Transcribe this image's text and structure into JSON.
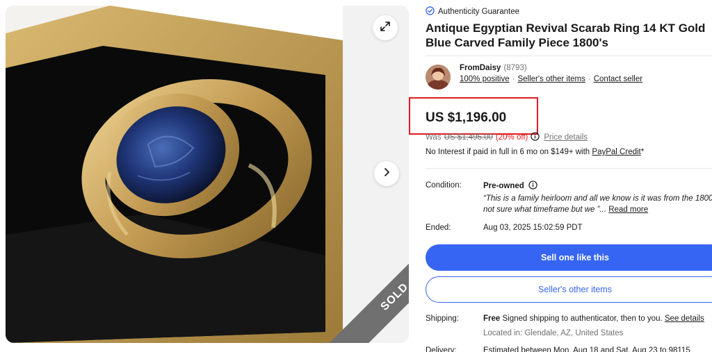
{
  "gallery": {
    "sold_label": "SOLD",
    "expand_icon": "expand-icon",
    "next_icon": "chevron-right-icon"
  },
  "listing": {
    "authenticity": "Authenticity Guarantee",
    "title": "Antique Egyptian Revival Scarab Ring 14 KT Gold Blue Carved Family Piece 1800's"
  },
  "seller": {
    "name": "FromDaisy",
    "feedback_count": "(8793)",
    "positive": "100% positive",
    "other_items": "Seller's other items",
    "contact": "Contact seller"
  },
  "pricing": {
    "price": "US $1,196.00",
    "was_label": "Was",
    "was_price": "US $1,495.00",
    "discount": "(20% off)",
    "price_details": "Price details",
    "interest_text": "No Interest if paid in full in 6 mo on $149+ with",
    "paypal_credit": "PayPal Credit",
    "asterisk": "*"
  },
  "details": {
    "condition_label": "Condition:",
    "condition_value": "Pre-owned",
    "condition_quote": "“This is a family heirloom and all we know is it was from the 1800's,",
    "condition_quote_2": "not sure what timeframe but we ”",
    "read_more": "Read more",
    "ended_label": "Ended:",
    "ended_value": "Aug 03, 2025 15:02:59 PDT"
  },
  "actions": {
    "sell_one": "Sell one like this",
    "sellers_other": "Seller's other items"
  },
  "shipping": {
    "label": "Shipping:",
    "free": "Free",
    "text": "Signed shipping to authenticator, then to you.",
    "see_details": "See details",
    "location": "Located in: Glendale, AZ, United States"
  },
  "delivery": {
    "label": "Delivery:",
    "value": "Estimated between Mon, Aug 18 and Sat, Aug 23 to 98115"
  },
  "colors": {
    "primary_blue": "#3665f3",
    "highlight_red": "#e0191d",
    "sold_ribbon": "#707070"
  }
}
